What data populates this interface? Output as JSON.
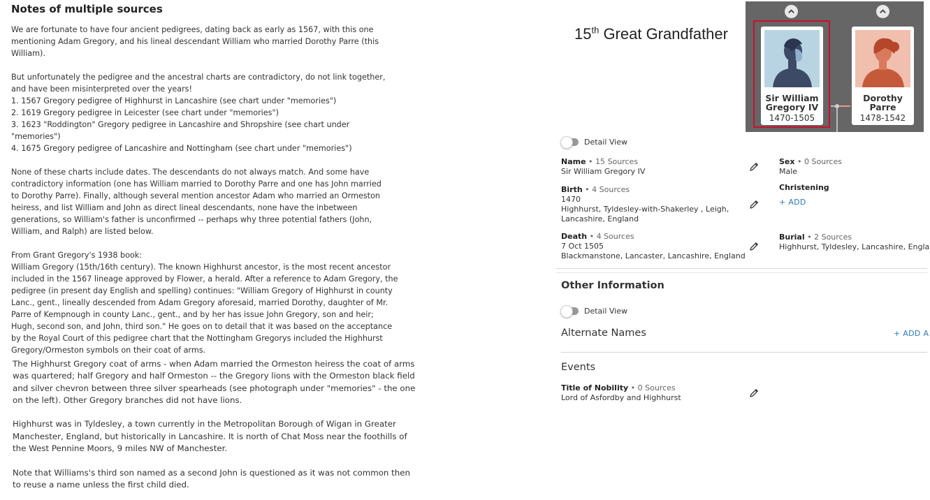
{
  "notes": {
    "title": "Notes of multiple sources",
    "block1": [
      "We are fortunate to have four ancient pedigrees, dating back as early as 1567, with this one",
      "mentioning Adam Gregory, and his lineal descendant William who married Dorothy Parre (this",
      "William).",
      "",
      "But unfortunately the pedigree and the ancestral charts are contradictory, do not link together,",
      "and have been misinterpreted over the years!",
      "1. 1567 Gregory pedigree of Highhurst in Lancashire (see chart under \"memories\")",
      "2. 1619 Gregory pedigree in Leicester (see chart under \"memories\")",
      "3. 1623 \"Roddington\" Gregory pedigree in Lancashire and Shropshire (see chart under",
      "\"memories\")",
      "4. 1675 Gregory pedigree of Lancashire and Nottingham (see chart under \"memories\")",
      "",
      "None of these charts include dates.  The descendants do not always match.  And some have",
      "contradictory information (one has William married to Dorothy Parre and one has John married",
      "to Dorothy Parre).  Finally, although several mention ancestor Adam who married an Ormeston",
      "heiress, and list William and John as direct lineal descendants, none have the inbetween",
      "generations, so William's father is unconfirmed -- perhaps why three potential fathers (John,",
      "William, and Ralph) are listed below.",
      "",
      "From Grant Gregory's 1938 book:",
      "William Gregory (15th/16th century).  The known Highhurst ancestor, is the most recent ancestor",
      "included in the 1567 lineage approved by Flower, a herald. After a reference to Adam Gregory, the",
      "pedigree (in present day English and spelling) continues: \"William Gregory of Highhurst in county",
      "Lanc., gent., lineally descended from Adam Gregory aforesaid, married Dorothy, daughter of Mr.",
      "Parre of Kempnough in county Lanc., gent., and by her has issue John Gregory, son and heir;",
      "Hugh, second son, and John, third son.\" He goes on to detail that it was based on the acceptance",
      "by the Royal Court of this pedigree chart that the Nottingham Gregorys included the Highhurst",
      "Gregory/Ormeston symbols on their coat of arms."
    ],
    "block2": [
      "The Highhurst Gregory coat of arms - when Adam married the Ormeston heiress the coat of arms",
      "was quartered; half Gregory and half Ormeston -- the Gregory lions with the Ormeston black field",
      "and silver chevron between three silver spearheads (see photograph under \"memories\" - the one",
      "on the left).  Other Gregory branches did not have lions.",
      "",
      "Highhurst was in Tyldesley, a town currently in the Metropolitan Borough of Wigan in Greater",
      "Manchester, England, but historically in Lancashire. It is north of Chat Moss near the foothills of",
      "the West Pennine Moors, 9 miles NW of Manchester.",
      "",
      "Note that Williams's third son named as a second John is questioned as it was not common then",
      "to reuse a name unless the first child died."
    ]
  },
  "heading": {
    "prefix": "15",
    "sup": "th",
    "suffix": " Great Grandfather"
  },
  "tree": {
    "persons": [
      {
        "name_line1": "Sir William",
        "name_line2": "Gregory IV",
        "dates": "1470-1505",
        "gender": "male",
        "selected": true
      },
      {
        "name_line1": "Dorothy",
        "name_line2": "Parre",
        "dates": "1478-1542",
        "gender": "female",
        "selected": false
      }
    ],
    "colors": {
      "male_bg": "#b8d4e3",
      "male_fg": "#3d4a66",
      "female_bg": "#f0bfae",
      "female_fg": "#c45a3a",
      "selected_border": "#c8102e",
      "panel_bg": "#666666"
    }
  },
  "details": {
    "toggle_label": "Detail View",
    "name": {
      "label": "Name",
      "sources": " • 15 Sources",
      "value": "Sir William Gregory IV"
    },
    "sex": {
      "label": "Sex",
      "sources": " • 0 Sources",
      "value": "Male"
    },
    "birth": {
      "label": "Birth",
      "sources": " • 4 Sources",
      "date": "1470",
      "place_line1": "Highhurst, Tyldesley-with-Shakerley , Leigh,",
      "place_line2": "Lancashire, England"
    },
    "christening": {
      "label": "Christening",
      "add": "+  ADD"
    },
    "death": {
      "label": "Death",
      "sources": " • 4 Sources",
      "date": "7 Oct 1505",
      "place": "Blackmanstone, Lancaster, Lancashire, England"
    },
    "burial": {
      "label": "Burial",
      "sources": " • 2 Sources",
      "place": "Highhurst, Tyldesley, Lancashire, England"
    }
  },
  "other": {
    "title": "Other Information",
    "toggle_label": "Detail View",
    "alternate_names": {
      "title": "Alternate Names",
      "add": "+  ADD A"
    },
    "events": {
      "title": "Events",
      "items": [
        {
          "label": "Title of Nobility",
          "sources": " • 0 Sources",
          "value": "Lord of Asfordby and Highhurst"
        }
      ]
    }
  },
  "icons": {
    "chevron": "chevron-up-icon",
    "edit": "pencil-icon",
    "portrait": "person-silhouette-icon"
  }
}
